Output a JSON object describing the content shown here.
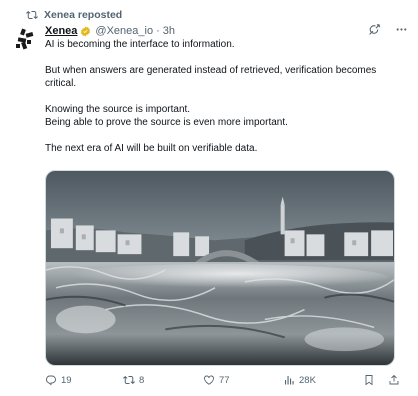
{
  "repost": {
    "label": "Xenea reposted"
  },
  "author": {
    "name": "Xenea",
    "handle": "@Xenea_io",
    "separator": "·",
    "time": "3h"
  },
  "post": {
    "lines": [
      "AI is becoming the interface to information.",
      "But when answers are generated instead of retrieved, verification becomes critical.",
      "Knowing the source is important.",
      "Being able to prove the source is even more important.",
      "The next era of AI will be built on verifiable data."
    ]
  },
  "actions": {
    "replies": "19",
    "reposts": "8",
    "likes": "77",
    "views": "28K"
  },
  "icons": {
    "repost_header": "repost-icon",
    "grok": "grok-icon",
    "more": "more-icon",
    "reply": "reply-icon",
    "repost": "repost-icon",
    "like": "heart-icon",
    "views": "views-icon",
    "bookmark": "bookmark-icon",
    "share": "share-icon"
  },
  "colors": {
    "text": "#0f1419",
    "secondary": "#536471",
    "verified_gold": "#e2b719"
  }
}
